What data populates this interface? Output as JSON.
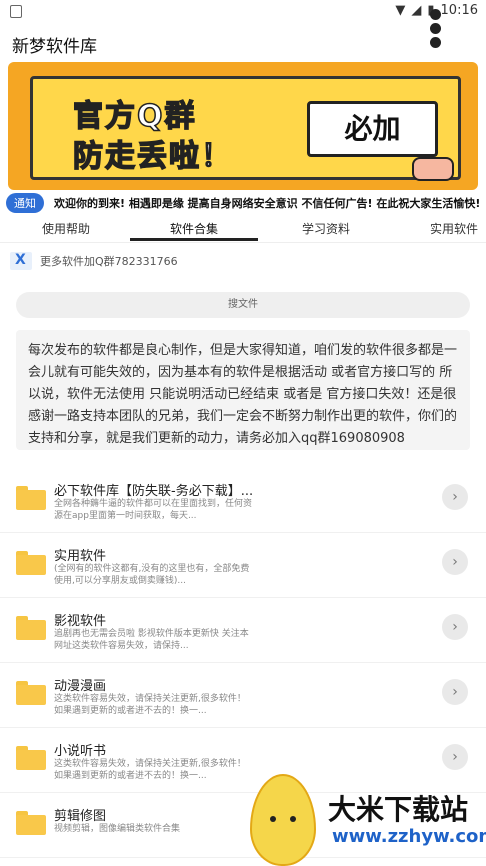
{
  "status": {
    "time": "10:16"
  },
  "app": {
    "title": "新梦软件库"
  },
  "banner": {
    "line1": "官方Q群",
    "line2": "防走丢啦！",
    "tag": "必加"
  },
  "notice": {
    "label": "通知",
    "text": "欢迎你的到来! 相遇即是缘 提高自身网络安全意识 不信任何广告! 在此祝大家生活愉快!"
  },
  "tabs": [
    {
      "label": "使用帮助"
    },
    {
      "label": "软件合集"
    },
    {
      "label": "学习资料"
    },
    {
      "label": "实用软件"
    }
  ],
  "group": {
    "text": "更多软件加Q群782331766"
  },
  "search": {
    "placeholder": "搜文件"
  },
  "intro": {
    "text": "每次发布的软件都是良心制作，但是大家得知道，咱们发的软件很多都是一会儿就有可能失效的，因为基本有的软件是根据活动 或者官方接口写的 所以说，软件无法使用 只能说明活动已经结束 或者是 官方接口失效！还是很感谢一路支持本团队的兄弟，我们一定会不断努力制作出更的软件，你们的支持和分享，就是我们更新的动力，请务必加入qq群169080908"
  },
  "items": [
    {
      "title": "必下软件库【防失联-务必下载】...",
      "desc": "全网各种薅牛逼的软件都可以在里面找到，任何资源在app里面第一时间获取，每天..."
    },
    {
      "title": "实用软件",
      "desc": "(全网有的软件这都有,没有的这里也有，全部免费使用,可以分享朋友或倒卖赚钱)..."
    },
    {
      "title": "影视软件",
      "desc": "追剧再也无需会员啦 影视软件版本更新快 关注本网址这类软件容易失效，请保持..."
    },
    {
      "title": "动漫漫画",
      "desc": "这类软件容易失效，请保持关注更新,很多软件！如果遇到更新的或者进不去的！换一..."
    },
    {
      "title": "小说听书",
      "desc": "这类软件容易失效，请保持关注更新,很多软件！如果遇到更新的或者进不去的！换一..."
    },
    {
      "title": "剪辑修图",
      "desc": "视频剪辑，图像编辑类软件合集"
    }
  ],
  "watermark": {
    "name": "大米下载站",
    "url": "www.zzhyw.com"
  }
}
